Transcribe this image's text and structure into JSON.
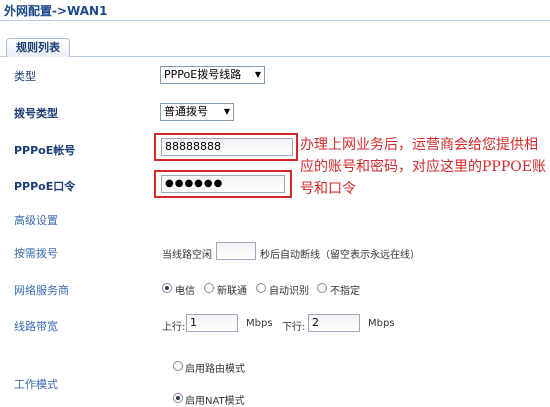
{
  "header": {
    "title": "外网配置->WAN1"
  },
  "tabs": [
    {
      "label": "规则列表"
    }
  ],
  "form": {
    "type_label": "类型",
    "type_value": "PPPoE拨号线路",
    "dial_type_label": "拨号类型",
    "dial_type_value": "普通拨号",
    "account_label": "PPPoE帐号",
    "account_value": "88888888",
    "password_label": "PPPoE口令",
    "password_value": "●●●●●●",
    "advanced_label": "高级设置",
    "on_demand_label": "按需拨号",
    "idle_prefix": "当线路空闲",
    "idle_suffix": "秒后自动断线（留空表示永远在线）",
    "idle_value": "",
    "isp_label": "网络服务商",
    "isp_options": [
      "电信",
      "新联通",
      "自动识别",
      "不指定"
    ],
    "isp_selected": 0,
    "bandwidth_label": "线路带宽",
    "upload_label": "上行:",
    "upload_value": "1",
    "upload_unit": "Mbps",
    "download_label": "下行:",
    "download_value": "2",
    "download_unit": "Mbps",
    "work_mode_label": "工作模式",
    "work_mode_options": [
      "启用路由模式",
      "启用NAT模式"
    ],
    "work_mode_selected": 1
  },
  "annotation": {
    "text": "办理上网业务后，运营商会给您提供相应的账号和密码，对应这里的PPPOE账号和口令",
    "color": "#d22a2a"
  },
  "colors": {
    "label": "#1a3d75",
    "accent_red": "#d22a2a",
    "tab_border": "#a9bcd8"
  }
}
